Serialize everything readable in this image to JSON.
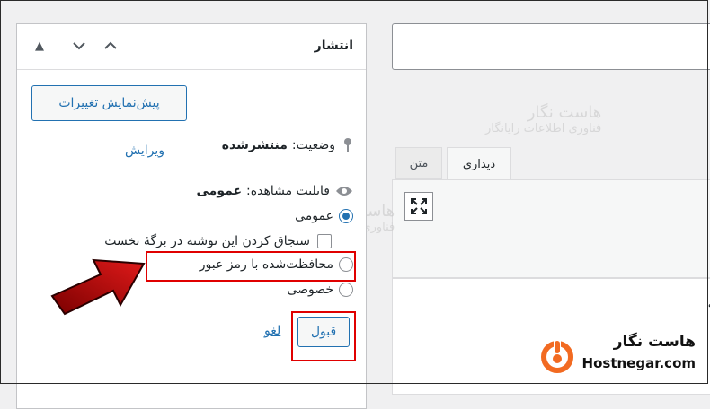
{
  "publish": {
    "title": "انتشار",
    "preview_label": "پیش‌نمایش تغییرات",
    "status": {
      "label": "وضعیت:",
      "value": "منتشرشده",
      "edit_link": "ویرایش"
    },
    "visibility": {
      "label": "قابلیت مشاهده:",
      "value": "عمومی"
    },
    "options": {
      "public": "عمومی",
      "sticky": "سنجاق کردن این نوشته در برگهٔ نخست",
      "password": "محافظت‌شده با رمز عبور",
      "private": "خصوصی"
    },
    "ok_label": "قبول",
    "cancel_label": "لغو"
  },
  "editor": {
    "tabs": {
      "visual": "دیداری",
      "text": "متن"
    },
    "content_fragment": "یه"
  },
  "watermark": {
    "brand": "هاست نگار",
    "tagline": "فناوری اطلاعات رایانگار"
  },
  "logo": {
    "fa": "هاست نگار",
    "en": "Hostnegar.com"
  },
  "colors": {
    "accent": "#2271b1",
    "highlight": "#e00000",
    "arrow": "#c00000",
    "logo": "#f26a21"
  }
}
